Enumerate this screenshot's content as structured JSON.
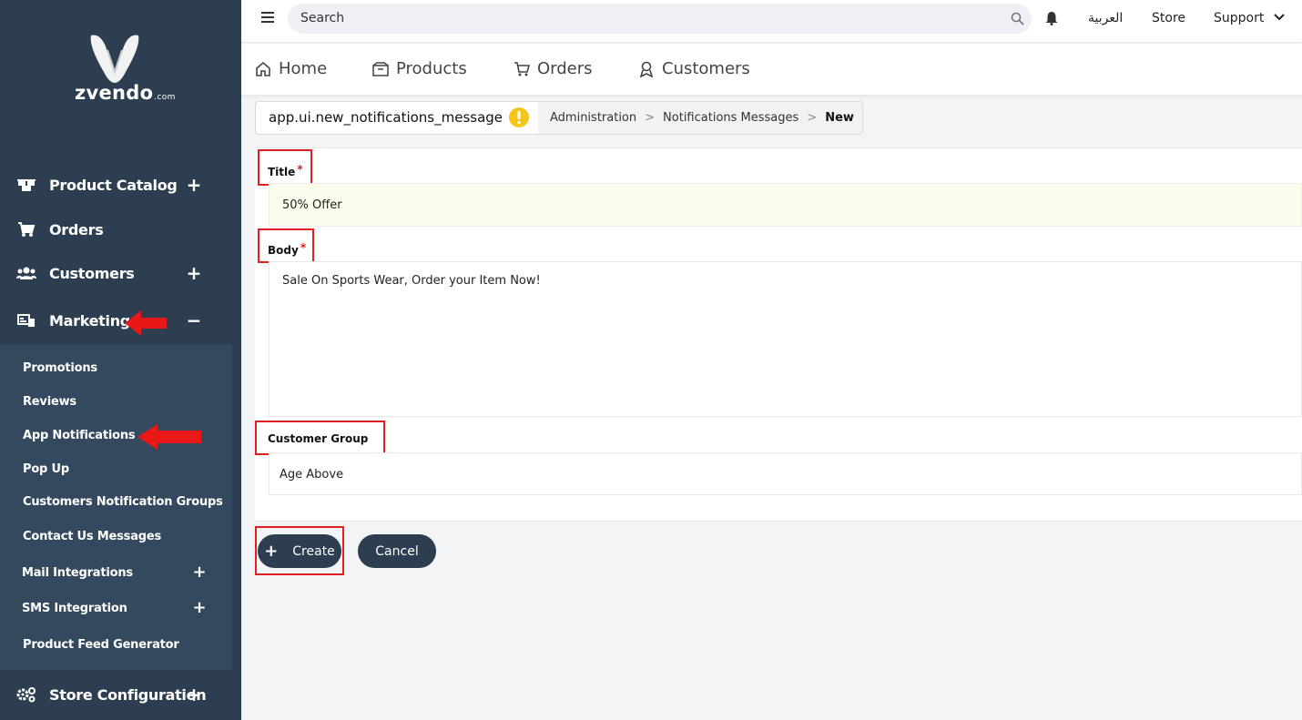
{
  "brand": {
    "logo_text": "zvendo",
    "logo_suffix": ".com"
  },
  "sidebar": {
    "items": [
      {
        "label": "Product Catalog",
        "toggle": "+"
      },
      {
        "label": "Orders"
      },
      {
        "label": "Customers",
        "toggle": "+"
      },
      {
        "label": "Marketing",
        "toggle": "−"
      },
      {
        "label": "Store Configuration",
        "toggle": "+"
      }
    ],
    "marketing_submenu": [
      {
        "label": "Promotions"
      },
      {
        "label": "Reviews"
      },
      {
        "label": "App Notifications"
      },
      {
        "label": "Pop Up"
      },
      {
        "label": "Customers Notification Groups"
      },
      {
        "label": "Contact Us Messages"
      },
      {
        "label": "Mail Integrations",
        "toggle": "+"
      },
      {
        "label": "SMS Integration",
        "toggle": "+"
      },
      {
        "label": "Product Feed Generator"
      }
    ]
  },
  "topbar": {
    "search_placeholder": "Search",
    "language": "العربية",
    "store": "Store",
    "support": "Support"
  },
  "mainnav": {
    "home": "Home",
    "products": "Products",
    "orders": "Orders",
    "customers": "Customers"
  },
  "breadcrumb": {
    "page_title": "app.ui.new_notifications_message",
    "items": [
      "Administration",
      "Notifications Messages",
      "New"
    ]
  },
  "form": {
    "title_label": "Title",
    "title_value": "50% Offer",
    "body_label": "Body",
    "body_value": "Sale On Sports Wear, Order your Item Now!",
    "group_label": "Customer Group",
    "group_value": "Age Above",
    "required_mark": "*"
  },
  "actions": {
    "create": "Create",
    "cancel": "Cancel",
    "create_icon": "+"
  },
  "colors": {
    "sidebar": "#2c3e50",
    "submenu": "#34495e",
    "highlight": "#e02020",
    "warning": "#f5c518"
  }
}
